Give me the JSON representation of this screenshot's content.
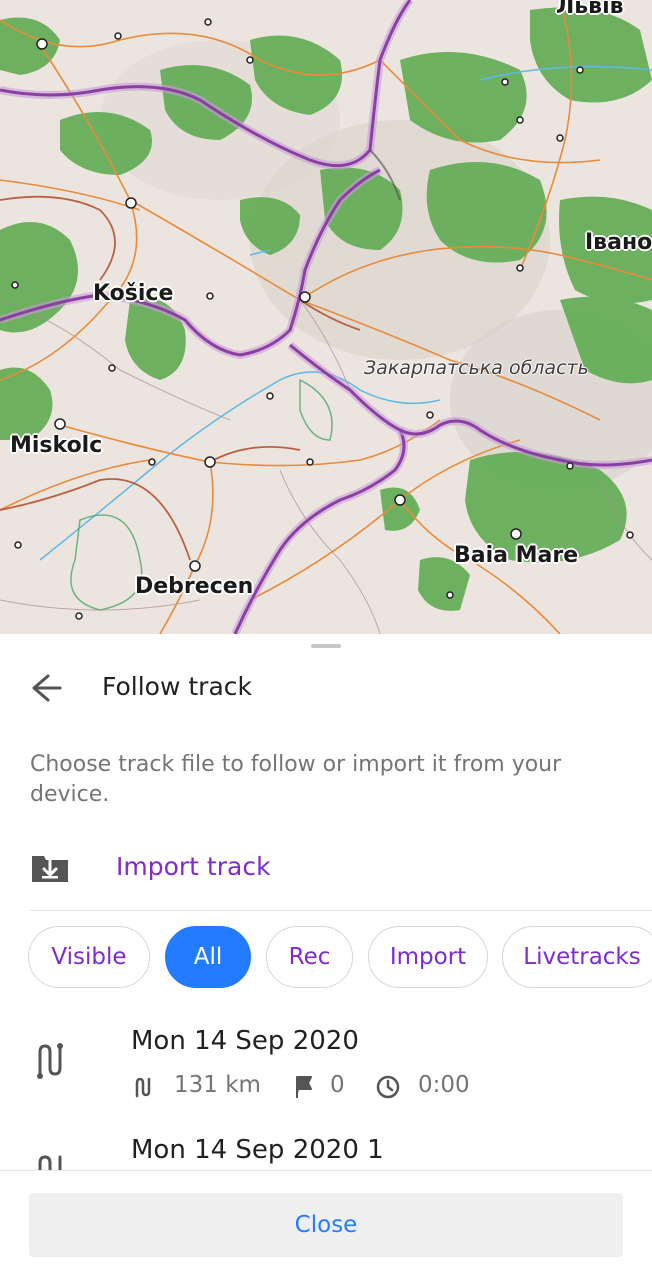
{
  "map": {
    "cities": [
      "Львів",
      "Івано",
      "Košice",
      "Miskolc",
      "Debrecen",
      "Baia Mare"
    ],
    "region": "Закарпатська область"
  },
  "sheet": {
    "title": "Follow track",
    "description": "Choose track file to follow or import it from your device.",
    "import_label": "Import track",
    "filters": [
      "Visible",
      "All",
      "Rec",
      "Import",
      "Livetracks"
    ],
    "active_filter": "All",
    "tracks": [
      {
        "name": "Mon 14 Sep 2020",
        "distance": "131 km",
        "waypoints": "0",
        "duration": "0:00"
      },
      {
        "name": "Mon 14 Sep 2020 1"
      }
    ],
    "close_label": "Close"
  },
  "colors": {
    "accent_purple": "#7e2bd1",
    "active_blue": "#237bff",
    "border_purple": "#8b3fa3",
    "forest_green": "#58a94b",
    "road_orange": "#e98b3a"
  },
  "icons": {
    "back": "arrow-left-icon",
    "import": "import-download-icon",
    "track": "track-route-icon",
    "distance": "distance-icon",
    "waypoints": "flag-icon",
    "duration": "clock-icon"
  }
}
